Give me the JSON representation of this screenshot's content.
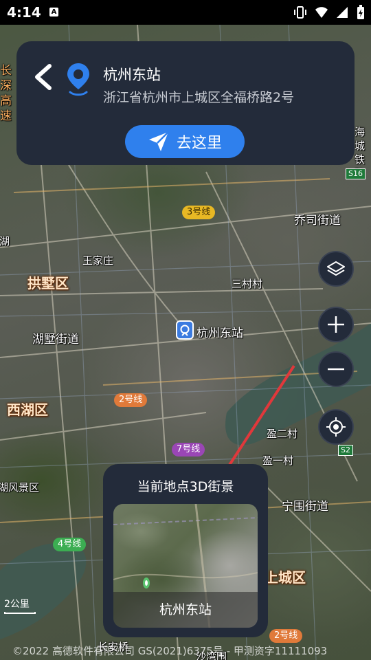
{
  "status_bar": {
    "time": "4:14",
    "a_badge": "A"
  },
  "place_card": {
    "title": "杭州东站",
    "address": "浙江省杭州市上城区全福桥路2号",
    "go_button_label": "去这里"
  },
  "map_labels": {
    "districts": [
      "拱墅区",
      "西湖区",
      "上城区"
    ],
    "places": [
      "杭州东站",
      "王家庄",
      "三村村",
      "乔司街道",
      "湖墅街道",
      "盈二村",
      "盈一村",
      "宁围街道",
      "西湖风景区",
      "长安桥",
      "沙湾围"
    ],
    "edge_labels": [
      "长深高速",
      "海城铁路",
      "净湖"
    ],
    "metro_lines": [
      "3号线",
      "2号线",
      "7号线",
      "4号线",
      "2号线"
    ],
    "highway_shields": [
      "S16",
      "S2"
    ]
  },
  "street_view_card": {
    "title": "当前地点3D街景",
    "caption": "杭州东站"
  },
  "scale_bar": "2公里",
  "copyright": "©2022 高德软件有限公司 GS(2021)6375号 - 甲测资字11111093",
  "icons": {
    "back": "back-chevron-icon",
    "pin": "location-pin-icon",
    "navigate": "navigate-arrow-icon",
    "layers": "layers-icon",
    "zoom_in": "plus-icon",
    "zoom_out": "minus-icon",
    "locate": "locate-target-icon"
  },
  "colors": {
    "accent": "#2f80ed",
    "card_bg": "#232b3a",
    "pin": "#2f80ed",
    "annotation_arrow": "#e0383b"
  }
}
